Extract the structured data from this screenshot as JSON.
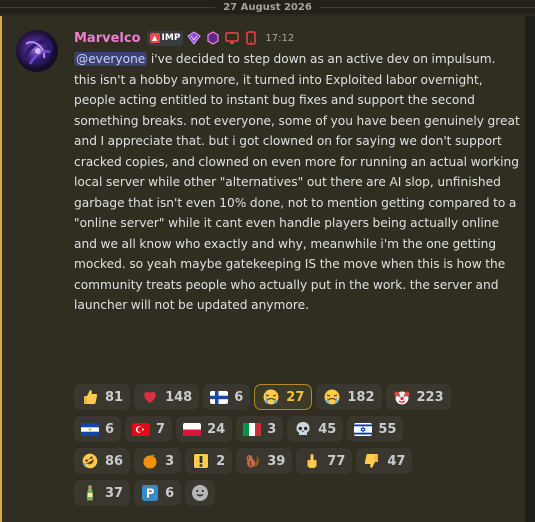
{
  "date_divider": "27 August 2026",
  "message": {
    "author": "Marvelco",
    "tag": "IMP",
    "timestamp": "17:12",
    "mention": "@everyone",
    "text": " i've decided to step down as an active dev on impulsum. this isn't a hobby anymore, it turned into Exploited labor overnight, people acting entitled to instant bug fixes and support the second something breaks. not everyone, some of you have been genuinely great and I appreciate that. but i got clowned on for saying we don't support cracked copies, and clowned on even more for running an actual working local server while other \"alternatives\" out there are AI slop, unfinished garbage that isn't even 10% done, not to mention getting compared to a \"online server\" while it cant even handle players being actually online and we all know who exactly and why, meanwhile i'm the one getting mocked. so yeah maybe gatekeeping IS the move when this is how the community treats people who actually put in the work. the server and launcher will not be updated anymore."
  },
  "reactions": {
    "row1": [
      {
        "icon": "thumbs-up-icon",
        "count": "81"
      },
      {
        "icon": "red-heart-icon",
        "count": "148"
      },
      {
        "icon": "flag-finland-icon",
        "count": "6"
      },
      {
        "icon": "crying-face-icon",
        "count": "27",
        "active": true
      },
      {
        "icon": "crying-face-icon",
        "count": "182"
      },
      {
        "icon": "clown-face-icon",
        "count": "223"
      }
    ],
    "row2": [
      {
        "icon": "flag-el-salvador-icon",
        "count": "6"
      },
      {
        "icon": "flag-turkey-icon",
        "count": "7"
      },
      {
        "icon": "flag-poland-icon",
        "count": "24"
      },
      {
        "icon": "flag-italy-icon",
        "count": "3"
      },
      {
        "icon": "skull-icon",
        "count": "45"
      },
      {
        "icon": "flag-israel-icon",
        "count": "55"
      }
    ],
    "row3": [
      {
        "icon": "rofl-face-icon",
        "count": "86"
      },
      {
        "icon": "tangerine-icon",
        "count": "3"
      },
      {
        "icon": "exclamation-icon",
        "count": "2"
      },
      {
        "icon": "chipmunk-icon",
        "count": "39"
      },
      {
        "icon": "middle-finger-icon",
        "count": "77"
      },
      {
        "icon": "thumbs-down-icon",
        "count": "47"
      }
    ],
    "row4": [
      {
        "icon": "bottle-icon",
        "count": "37"
      },
      {
        "icon": "parking-p-icon",
        "count": "6"
      }
    ]
  },
  "colors": {
    "accent_bar": "#d9a93a",
    "username": "#ee7fd0",
    "mention_bg": "#3c4270"
  }
}
